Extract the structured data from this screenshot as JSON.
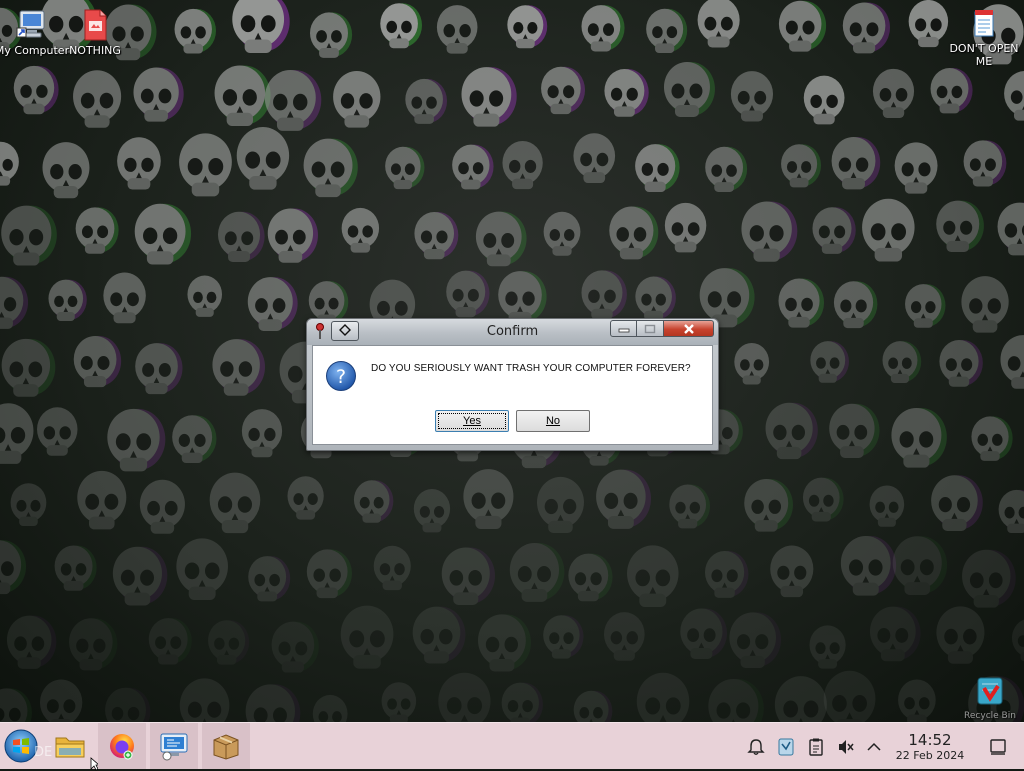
{
  "desktop": {
    "icons": [
      {
        "label": "My Computer"
      },
      {
        "label": "NOTHING"
      },
      {
        "label": "DON'T OPEN ME"
      },
      {
        "label": "Recycle Bin"
      }
    ]
  },
  "dialog": {
    "title": "Confirm",
    "message": "DO YOU SERIOUSLY WANT TRASH YOUR COMPUTER FOREVER?",
    "yes_label": "Yes",
    "no_label": "No"
  },
  "taskbar": {
    "start_fragment": "DE",
    "clock_time": "14:52",
    "clock_date": "22 Feb 2024"
  },
  "colors": {
    "taskbar": "#e8d2d8",
    "close_button": "#c7432f",
    "question_icon": "#2f6fc2"
  }
}
